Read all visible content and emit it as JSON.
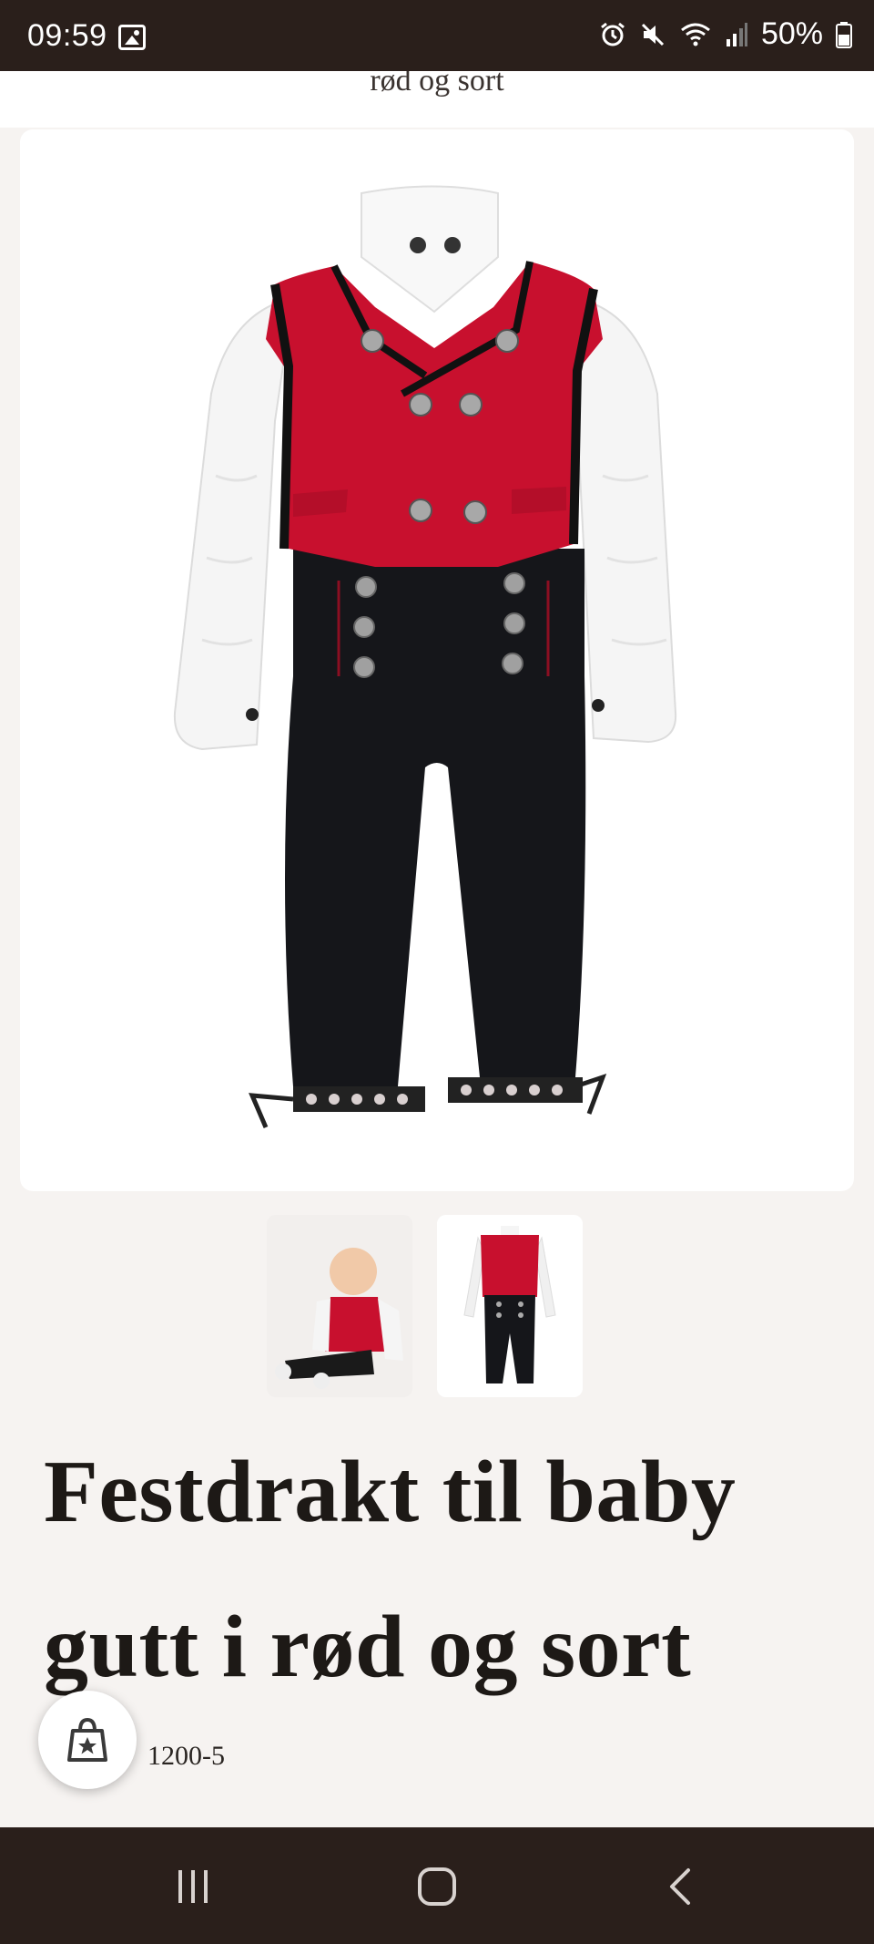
{
  "status_bar": {
    "time": "09:59",
    "battery": "50%",
    "icons": [
      "image-icon",
      "alarm-icon",
      "mute-icon",
      "wifi-icon",
      "signal-icon",
      "battery-icon"
    ]
  },
  "header": {
    "clipped_title": "rød og sort"
  },
  "product": {
    "title": "Festdrakt til baby gutt i rød og sort",
    "sku": "1200-5",
    "main_image_alt": "Red vest and black knickers outfit with white shirt",
    "thumbnails": [
      "baby-wearing-outfit",
      "outfit-front"
    ]
  },
  "colors": {
    "vest_red": "#c8102e",
    "pants_black": "#15161a",
    "shirt_white": "#f7f7f7",
    "button_silver": "#9a9a9a",
    "bar_dark": "#2a1f1b",
    "page_bg": "#f6f3f1"
  },
  "nav": {
    "buttons": [
      "recents-button",
      "home-button",
      "back-button"
    ]
  }
}
